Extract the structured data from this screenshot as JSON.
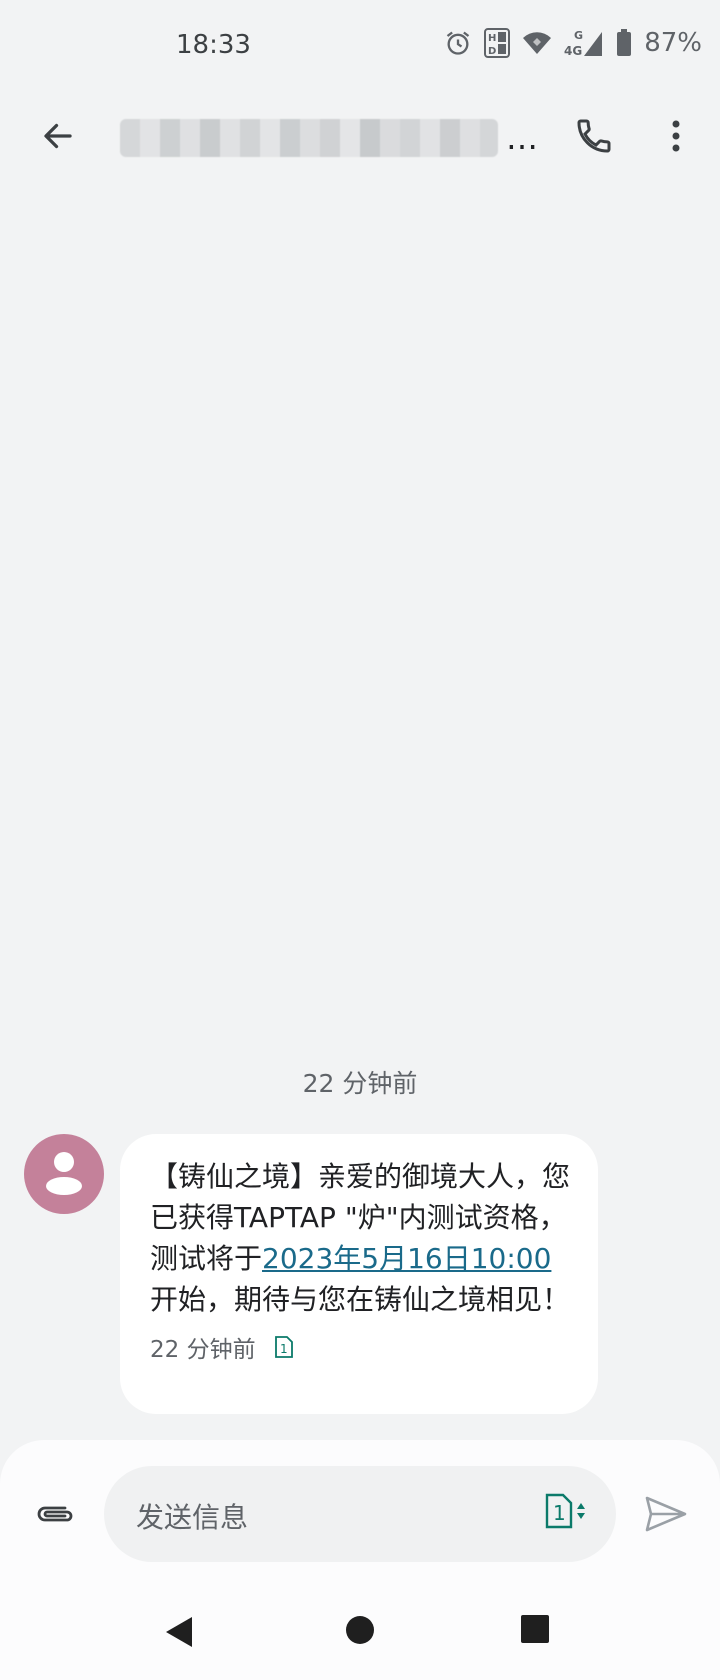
{
  "status_bar": {
    "time": "18:33",
    "battery_percent": "87%",
    "icons": [
      "alarm-icon",
      "hd-icon",
      "wifi-icon",
      "network-4g-icon",
      "signal-icon",
      "battery-icon"
    ]
  },
  "app_bar": {
    "contact_title_suffix": "…",
    "back_icon": "arrow-back-icon",
    "call_icon": "phone-icon",
    "more_icon": "more-vert-icon"
  },
  "conversation": {
    "timestamp_header": "22 分钟前",
    "message": {
      "text_before": "【铸仙之境】亲爱的御境大人，您已获得TAPTAP \"炉\"内测试资格，测试将于",
      "link_text": "2023年5月16日10:00",
      "text_after": "开始，期待与您在铸仙之境相见！",
      "timestamp": "22 分钟前",
      "sim_slot": "1"
    },
    "avatar_color": "#c4819a"
  },
  "compose": {
    "placeholder": "发送信息",
    "sim_slot": "1",
    "attach_icon": "paperclip-icon",
    "send_icon": "send-icon"
  },
  "colors": {
    "background": "#f2f3f4",
    "bubble": "#ffffff",
    "link": "#1a6a8a",
    "sim_accent": "#0b7a6a"
  },
  "nav_bar": {
    "icons": [
      "nav-back-icon",
      "nav-home-icon",
      "nav-recents-icon"
    ]
  }
}
